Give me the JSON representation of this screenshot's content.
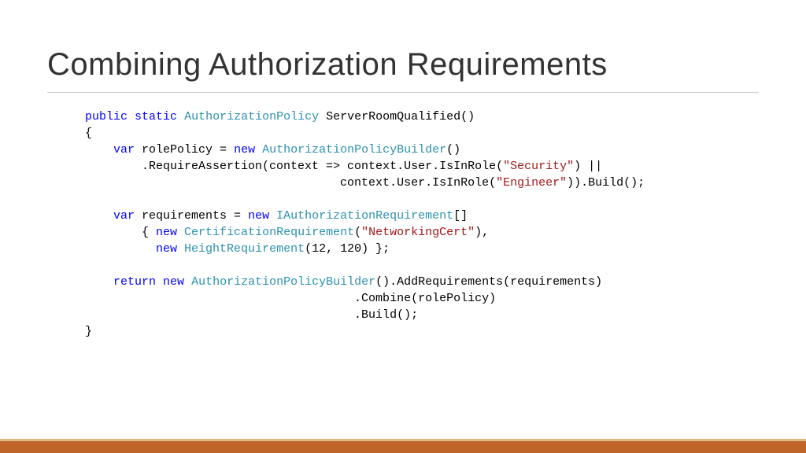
{
  "title": "Combining Authorization Requirements",
  "code": {
    "kw_public": "public",
    "kw_static": "static",
    "type_authpolicy": "AuthorizationPolicy",
    "method_name": " ServerRoomQualified()",
    "brace_open": "{",
    "kw_var1": "var",
    "rolepolicy_eq": " rolePolicy = ",
    "kw_new1": "new",
    "type_authpolicybuilder1": " AuthorizationPolicyBuilder",
    "builder_call1": "()",
    "require_line": "        .RequireAssertion(context => context.User.IsInRole(",
    "str_security": "\"Security\"",
    "require_tail": ") ||",
    "engineer_pre": "                                    context.User.IsInRole(",
    "str_engineer": "\"Engineer\"",
    "engineer_tail": ")).Build();",
    "kw_var2": "var",
    "requirements_eq": " requirements = ",
    "kw_new2": "new",
    "type_iauthreq": " IAuthorizationRequirement",
    "arr_open": "[]",
    "arr_brace": "    { ",
    "kw_new3": "new",
    "type_certreq": " CertificationRequirement",
    "cert_call_open": "(",
    "str_netcert": "\"NetworkingCert\"",
    "cert_call_close": "),",
    "height_indent": "      ",
    "kw_new4": "new",
    "type_heightreq": " HeightRequirement",
    "height_args": "(12, 120) };",
    "kw_return": "return",
    "sp": " ",
    "kw_new5": "new",
    "type_authpolicybuilder2": " AuthorizationPolicyBuilder",
    "addreq": "().AddRequirements(requirements)",
    "combine_line": "                                      .Combine(rolePolicy)",
    "build_line": "                                      .Build();",
    "brace_close": "}"
  }
}
